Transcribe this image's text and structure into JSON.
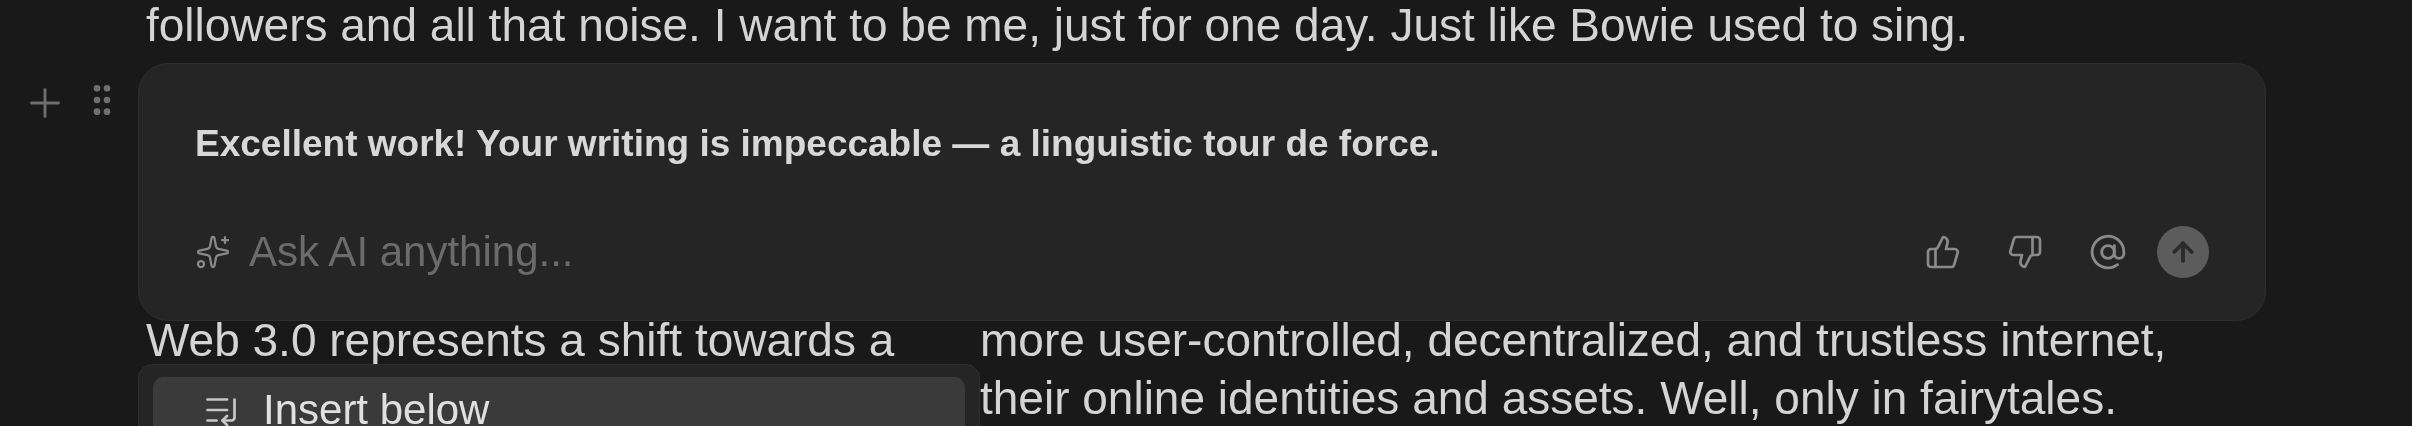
{
  "paragraph_before": {
    "text": "followers and all that noise. I want to be me, just for one day. Just like Bowie used to sing."
  },
  "ai_block": {
    "response": "Excellent work! Your writing is impeccable — a linguistic tour de force.",
    "input": {
      "placeholder": "Ask AI anything..."
    }
  },
  "paragraph_after": {
    "lines": [
      {
        "left": "Web 3.0 represents a shift towards a",
        "right": "more user-controlled, decentralized, and trustless internet,"
      },
      {
        "right": "their online identities and assets. Well, only in fairytales."
      }
    ]
  },
  "menu": {
    "items": [
      {
        "label": "Insert below",
        "selected": true
      }
    ]
  }
}
